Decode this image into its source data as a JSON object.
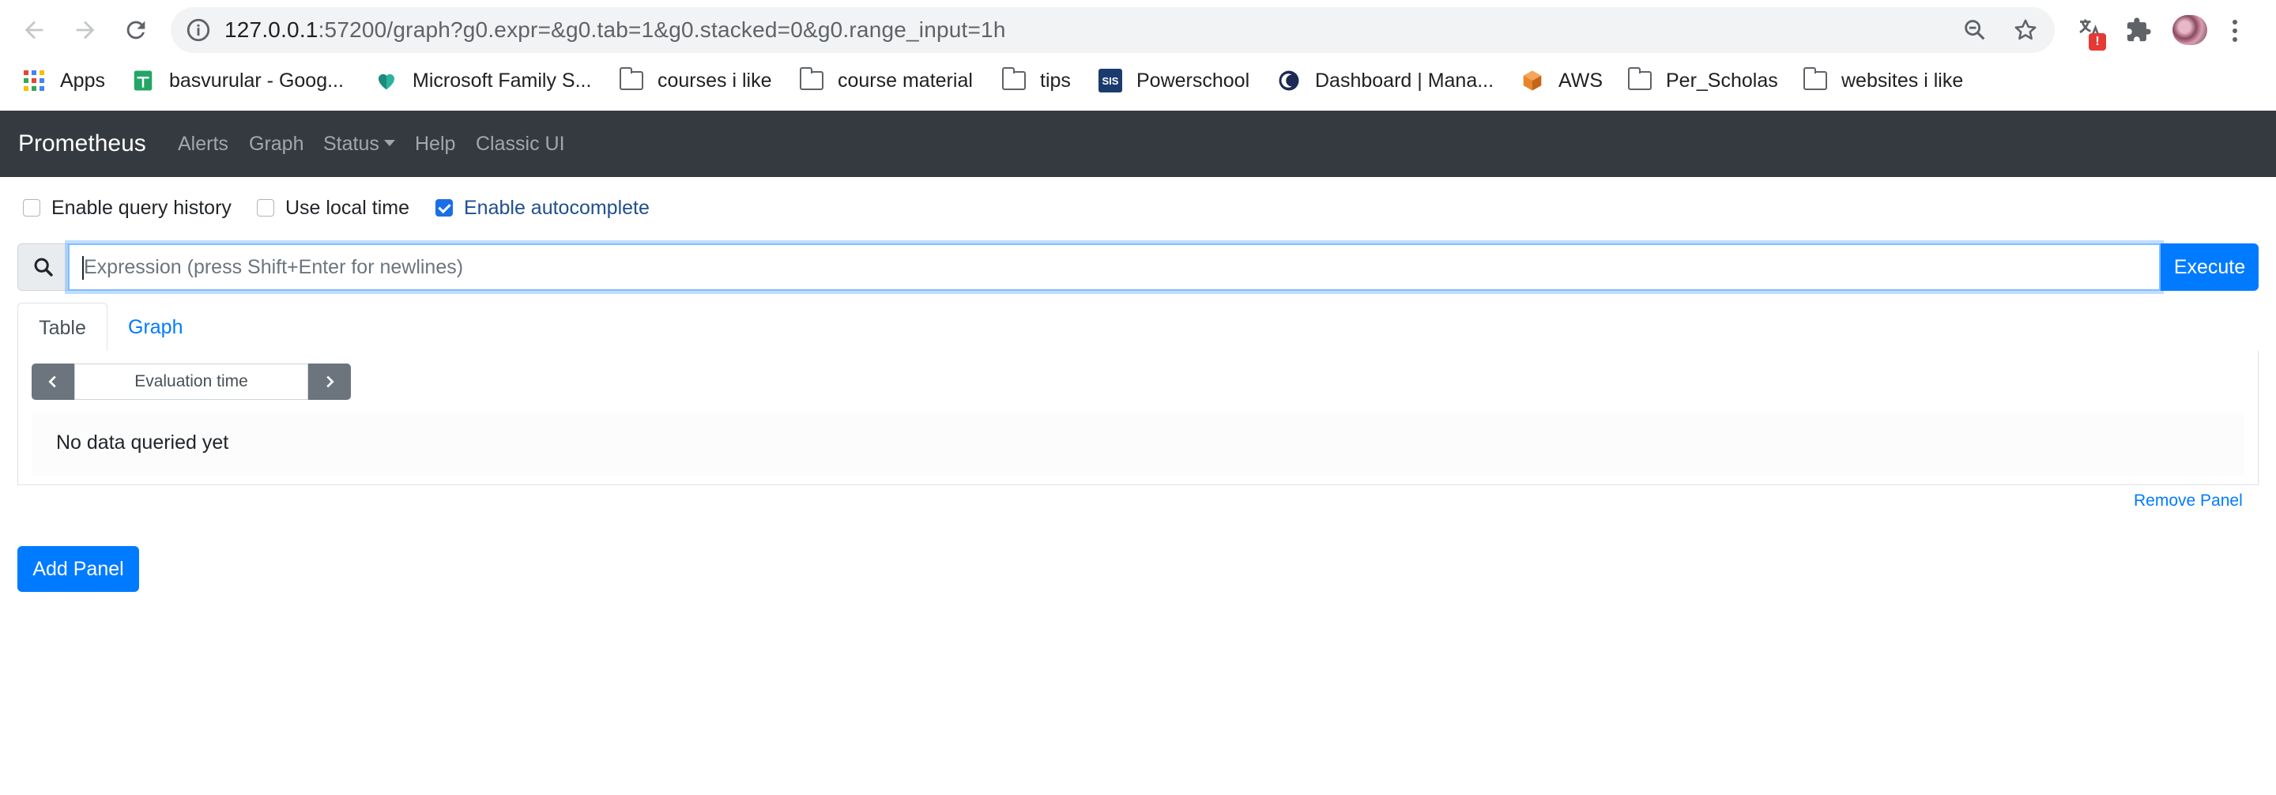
{
  "browser": {
    "url_host": "127.0.0.1",
    "url_rest": ":57200/graph?g0.expr=&g0.tab=1&g0.stacked=0&g0.range_input=1h",
    "extension_badge": "!",
    "bookmarks": [
      {
        "label": "Apps",
        "icon": "apps-grid-icon"
      },
      {
        "label": "basvurular - Goog...",
        "icon": "google-sheets-icon"
      },
      {
        "label": "Microsoft Family S...",
        "icon": "family-heart-icon"
      },
      {
        "label": "courses i like",
        "icon": "folder-icon"
      },
      {
        "label": "course material",
        "icon": "folder-icon"
      },
      {
        "label": "tips",
        "icon": "folder-icon"
      },
      {
        "label": "Powerschool",
        "icon": "sis-icon"
      },
      {
        "label": "Dashboard | Mana...",
        "icon": "moon-icon"
      },
      {
        "label": "AWS",
        "icon": "aws-cube-icon"
      },
      {
        "label": "Per_Scholas",
        "icon": "folder-icon"
      },
      {
        "label": "websites i like",
        "icon": "folder-icon"
      }
    ],
    "sis_text": "SIS"
  },
  "navbar": {
    "brand": "Prometheus",
    "links": [
      "Alerts",
      "Graph",
      "Status",
      "Help",
      "Classic UI"
    ]
  },
  "options": {
    "query_history": {
      "label": "Enable query history",
      "checked": false
    },
    "local_time": {
      "label": "Use local time",
      "checked": false
    },
    "autocomplete": {
      "label": "Enable autocomplete",
      "checked": true
    }
  },
  "expression": {
    "placeholder": "Expression (press Shift+Enter for newlines)",
    "execute_label": "Execute"
  },
  "panel": {
    "tabs": [
      "Table",
      "Graph"
    ],
    "active_tab": "Table",
    "eval_placeholder": "Evaluation time",
    "empty_message": "No data queried yet",
    "remove_label": "Remove Panel"
  },
  "add_panel_label": "Add Panel",
  "colors": {
    "navbar_bg": "#343a40",
    "primary": "#007bff",
    "secondary": "#6c757d"
  }
}
